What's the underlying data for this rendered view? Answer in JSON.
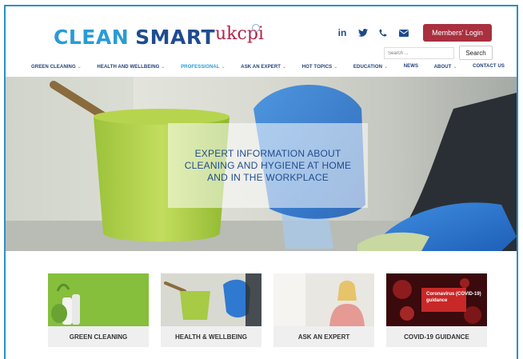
{
  "header": {
    "logo_clean": "CLEAN",
    "logo_smart": "SMART",
    "partner_logo": "ukcpi",
    "social_icons": [
      "linkedin-icon",
      "twitter-icon",
      "phone-icon",
      "email-icon"
    ],
    "social_linkedin_text": "in",
    "members_login": "Members' Login",
    "search_placeholder": "Search ...",
    "search_button": "Search"
  },
  "nav": {
    "items": [
      {
        "label": "GREEN CLEANING",
        "dropdown": true
      },
      {
        "label": "HEALTH AND WELLBEING",
        "dropdown": true
      },
      {
        "label": "PROFESSIONAL",
        "dropdown": true,
        "active": true
      },
      {
        "label": "ASK AN EXPERT",
        "dropdown": true
      },
      {
        "label": "HOT TOPICS",
        "dropdown": true
      },
      {
        "label": "EDUCATION",
        "dropdown": true
      },
      {
        "label": "NEWS",
        "dropdown": false
      },
      {
        "label": "ABOUT",
        "dropdown": true
      },
      {
        "label": "CONTACT US",
        "dropdown": false
      }
    ],
    "chevron": "⌄"
  },
  "hero": {
    "headline": "EXPERT INFORMATION ABOUT CLEANING AND HYGIENE AT HOME AND IN THE WORKPLACE"
  },
  "cards": [
    {
      "label": "GREEN CLEANING"
    },
    {
      "label": "HEALTH & WELLBEING"
    },
    {
      "label": "ASK AN EXPERT"
    },
    {
      "label": "COVID-19 GUIDANCE",
      "image_text": "Coronavirus (COVID-19) guidance"
    }
  ],
  "colors": {
    "accent_blue": "#2a9bd6",
    "brand_navy": "#1f4c8f",
    "login_red": "#a8303f",
    "frame_blue": "#2b8fc9"
  }
}
